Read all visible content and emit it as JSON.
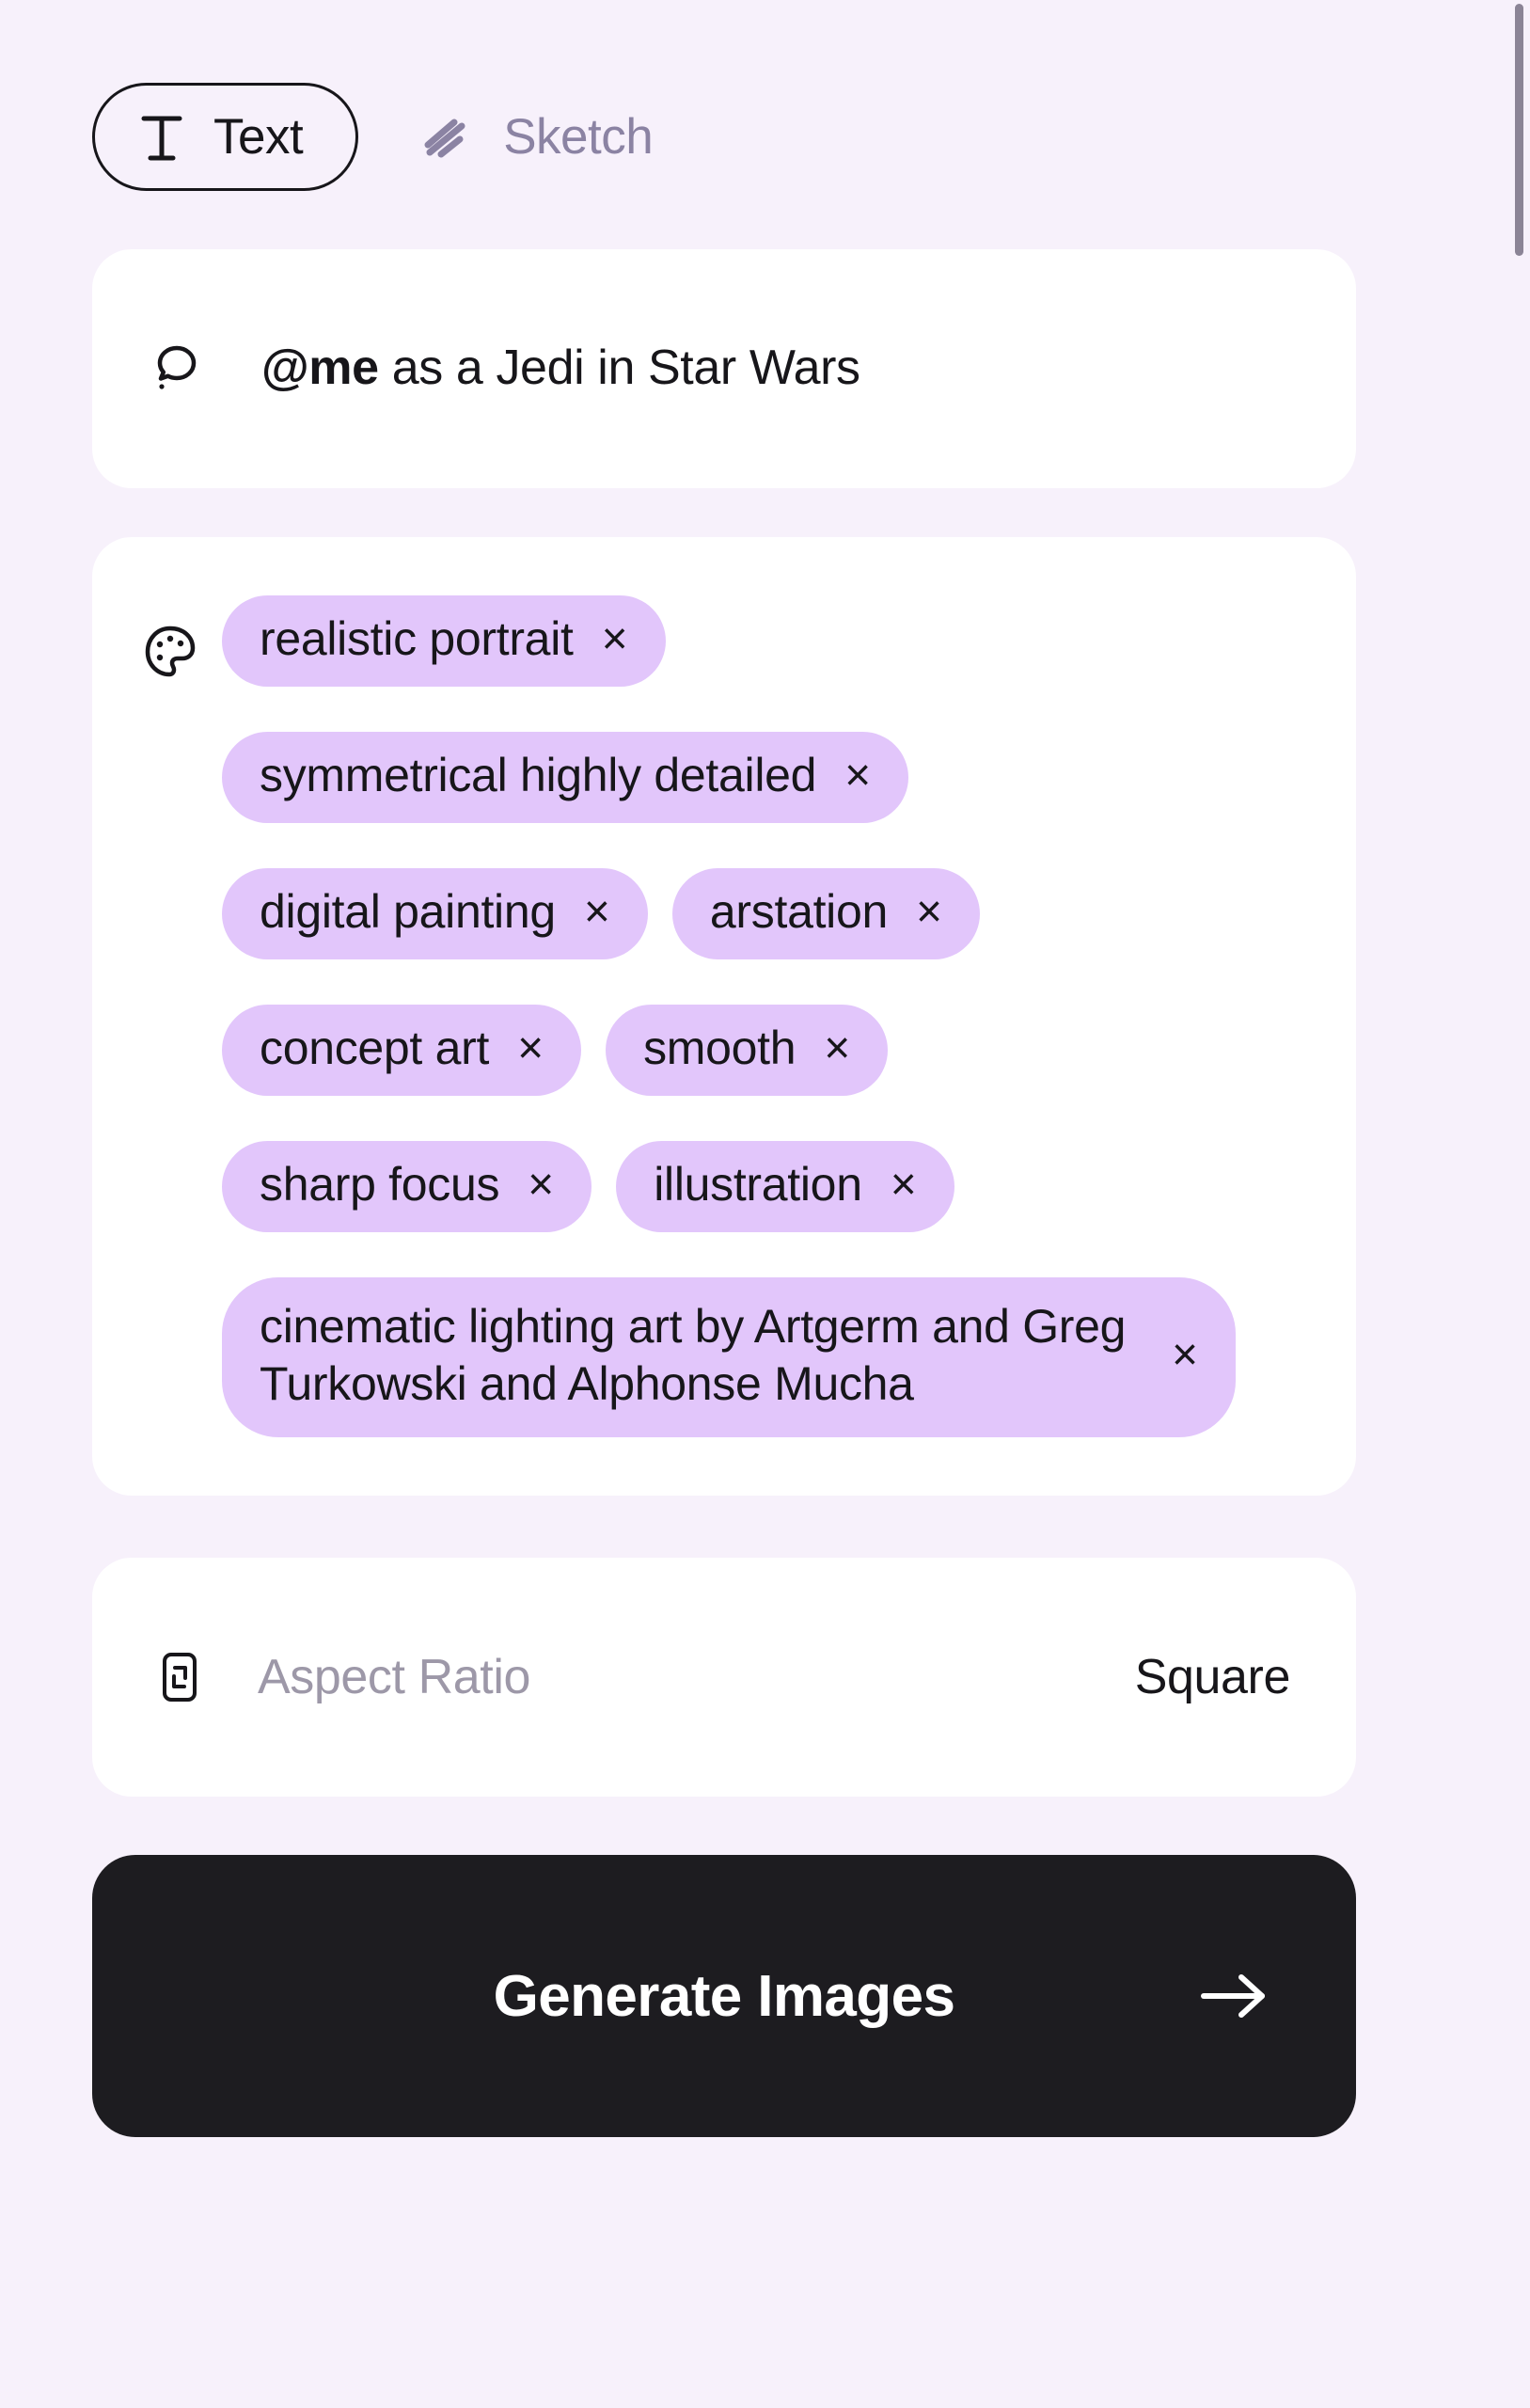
{
  "colors": {
    "page_background": "#f7f1fb",
    "card_background": "#ffffff",
    "tag_background": "#e2c6fb",
    "accent_dark": "#1d1c20",
    "muted_text": "#8b83a3",
    "placeholder_text": "#9d98a8",
    "scrollbar_thumb": "#8b8496"
  },
  "mode_tabs": [
    {
      "id": "text",
      "label": "Text",
      "icon": "text-format-icon",
      "active": true
    },
    {
      "id": "sketch",
      "label": "Sketch",
      "icon": "sketch-strokes-icon",
      "active": false
    }
  ],
  "prompt": {
    "icon": "speech-bubble-icon",
    "mention": "@me",
    "rest": " as a Jedi in Star Wars",
    "full_text": "@me as a Jedi in Star Wars"
  },
  "styles": {
    "icon": "palette-icon",
    "remove_glyph": "×",
    "tags": [
      {
        "label": "realistic portrait",
        "multiline": false,
        "break_after": true
      },
      {
        "label": "symmetrical highly detailed",
        "multiline": false,
        "break_after": true
      },
      {
        "label": "digital painting",
        "multiline": false,
        "break_after": false
      },
      {
        "label": "arstation",
        "multiline": false,
        "break_after": true
      },
      {
        "label": "concept art",
        "multiline": false,
        "break_after": false
      },
      {
        "label": "smooth",
        "multiline": false,
        "break_after": true
      },
      {
        "label": "sharp focus",
        "multiline": false,
        "break_after": false
      },
      {
        "label": "illustration",
        "multiline": false,
        "break_after": true
      },
      {
        "label": "cinematic lighting art by Artgerm and Greg Turkowski and Alphonse Mucha",
        "multiline": true,
        "break_after": true
      }
    ]
  },
  "aspect_ratio": {
    "icon": "aspect-ratio-icon",
    "label": "Aspect Ratio",
    "value": "Square"
  },
  "generate": {
    "label": "Generate Images",
    "arrow_icon": "arrow-right-icon"
  }
}
